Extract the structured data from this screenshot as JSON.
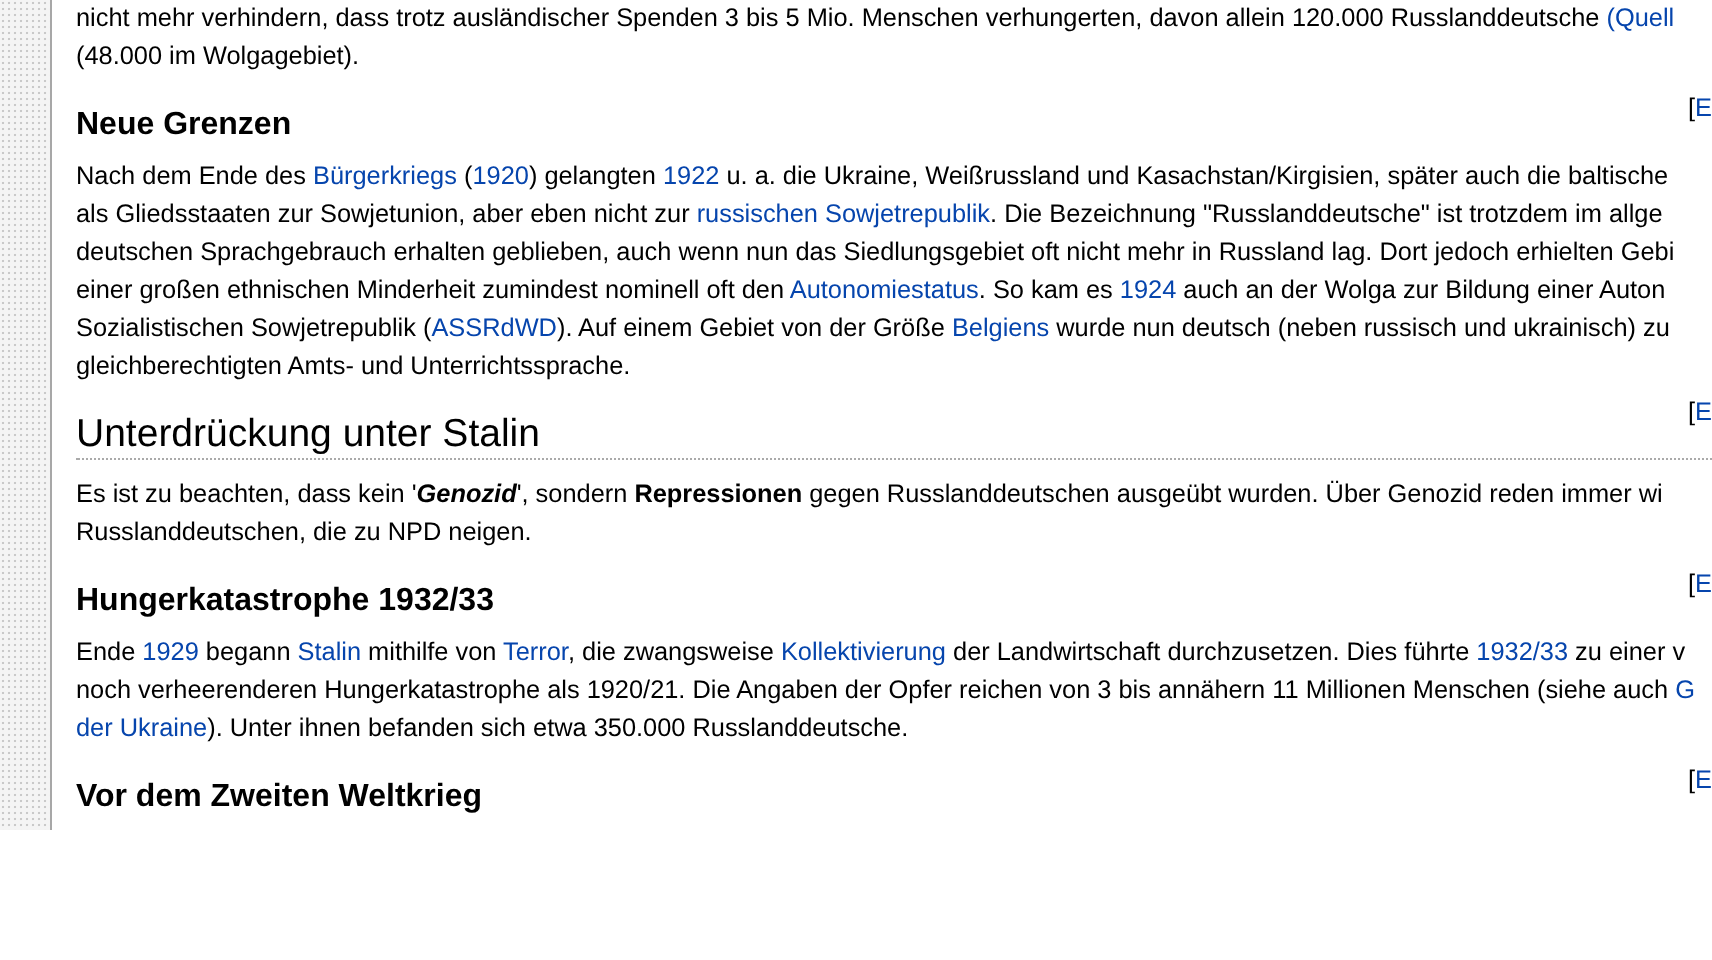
{
  "article": {
    "blocks": [
      {
        "kind": "paragraph",
        "lines": [
          [
            {
              "kind": "text",
              "text": "nicht mehr verhindern, dass trotz ausländischer Spenden 3 bis 5 Mio. Menschen verhungerten, davon allein 120.000 Russlanddeutsche "
            },
            {
              "kind": "link",
              "text": "(Quell"
            }
          ],
          [
            {
              "kind": "text",
              "text": "(48.000 im Wolgagebiet)."
            }
          ]
        ]
      },
      {
        "kind": "subsection_heading",
        "text": "Neue Grenzen",
        "edit": {
          "bracket": "[",
          "link": "E"
        }
      },
      {
        "kind": "paragraph",
        "lines": [
          [
            {
              "kind": "text",
              "text": "Nach dem Ende des "
            },
            {
              "kind": "link",
              "text": "Bürgerkriegs"
            },
            {
              "kind": "text",
              "text": " ("
            },
            {
              "kind": "link",
              "text": "1920"
            },
            {
              "kind": "text",
              "text": ") gelangten "
            },
            {
              "kind": "link",
              "text": "1922"
            },
            {
              "kind": "text",
              "text": " u. a. die Ukraine, Weißrussland und Kasachstan/Kirgisien, später auch die baltische"
            }
          ],
          [
            {
              "kind": "text",
              "text": "als Gliedsstaaten zur Sowjetunion, aber eben nicht zur "
            },
            {
              "kind": "link",
              "text": "russischen Sowjetrepublik"
            },
            {
              "kind": "text",
              "text": ". Die Bezeichnung \"Russlanddeutsche\" ist trotzdem im allge"
            }
          ],
          [
            {
              "kind": "text",
              "text": "deutschen Sprachgebrauch erhalten geblieben, auch wenn nun das Siedlungsgebiet oft nicht mehr in Russland lag. Dort jedoch erhielten Gebi"
            }
          ],
          [
            {
              "kind": "text",
              "text": "einer großen ethnischen Minderheit zumindest nominell oft den "
            },
            {
              "kind": "link",
              "text": "Autonomiestatus"
            },
            {
              "kind": "text",
              "text": ". So kam es "
            },
            {
              "kind": "link",
              "text": "1924"
            },
            {
              "kind": "text",
              "text": " auch an der Wolga zur Bildung einer Auton"
            }
          ],
          [
            {
              "kind": "text",
              "text": "Sozialistischen Sowjetrepublik ("
            },
            {
              "kind": "link",
              "text": "ASSRdWD"
            },
            {
              "kind": "text",
              "text": "). Auf einem Gebiet von der Größe "
            },
            {
              "kind": "link",
              "text": "Belgiens"
            },
            {
              "kind": "text",
              "text": " wurde nun deutsch (neben russisch und ukrainisch) zu"
            }
          ],
          [
            {
              "kind": "text",
              "text": "gleichberechtigten Amts- und Unterrichtssprache."
            }
          ]
        ]
      },
      {
        "kind": "section_heading",
        "text": "Unterdrückung unter Stalin",
        "edit": {
          "bracket": "[",
          "link": "E"
        }
      },
      {
        "kind": "paragraph",
        "lines": [
          [
            {
              "kind": "text",
              "text": "Es ist zu beachten, dass kein '"
            },
            {
              "kind": "bold_italic",
              "text": "Genozid"
            },
            {
              "kind": "text",
              "text": "', sondern "
            },
            {
              "kind": "bold",
              "text": "Repressionen"
            },
            {
              "kind": "text",
              "text": " gegen Russlanddeutschen ausgeübt wurden. Über Genozid reden immer wi"
            }
          ],
          [
            {
              "kind": "text",
              "text": "Russlanddeutschen, die zu NPD neigen."
            }
          ]
        ]
      },
      {
        "kind": "subsection_heading",
        "text": "Hungerkatastrophe 1932/33",
        "edit": {
          "bracket": "[",
          "link": "E"
        }
      },
      {
        "kind": "paragraph",
        "lines": [
          [
            {
              "kind": "text",
              "text": "Ende "
            },
            {
              "kind": "link",
              "text": "1929"
            },
            {
              "kind": "text",
              "text": " begann "
            },
            {
              "kind": "link",
              "text": "Stalin"
            },
            {
              "kind": "text",
              "text": " mithilfe von "
            },
            {
              "kind": "link",
              "text": "Terror"
            },
            {
              "kind": "text",
              "text": ", die zwangsweise "
            },
            {
              "kind": "link",
              "text": "Kollektivierung"
            },
            {
              "kind": "text",
              "text": " der Landwirtschaft durchzusetzen. Dies führte "
            },
            {
              "kind": "link",
              "text": "1932/33"
            },
            {
              "kind": "text",
              "text": " zu einer v"
            }
          ],
          [
            {
              "kind": "text",
              "text": "noch verheerenderen Hungerkatastrophe als 1920/21. Die Angaben der Opfer reichen von 3 bis annähern 11 Millionen Menschen (siehe auch "
            },
            {
              "kind": "link",
              "text": "G"
            }
          ],
          [
            {
              "kind": "link",
              "text": "der Ukraine"
            },
            {
              "kind": "text",
              "text": "). Unter ihnen befanden sich etwa 350.000 Russlanddeutsche."
            }
          ]
        ]
      },
      {
        "kind": "subsection_heading",
        "text": "Vor dem Zweiten Weltkrieg",
        "edit": {
          "bracket": "[",
          "link": "E"
        }
      }
    ]
  }
}
